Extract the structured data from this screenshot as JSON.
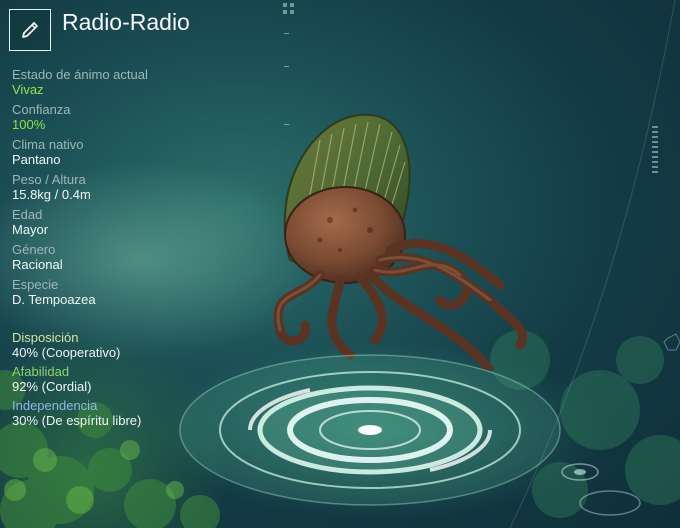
{
  "header": {
    "title": "Radio-Radio",
    "edit_icon": "pencil-icon"
  },
  "stats": [
    {
      "label": "Estado de ánimo actual",
      "value": "Vivaz",
      "highlight": true
    },
    {
      "label": "Confianza",
      "value": "100%",
      "highlight": true
    },
    {
      "label": "Clima nativo",
      "value": "Pantano",
      "highlight": false
    },
    {
      "label": "Peso / Altura",
      "value": "15.8kg / 0.4m",
      "highlight": false
    },
    {
      "label": "Edad",
      "value": "Mayor",
      "highlight": false
    },
    {
      "label": "Género",
      "value": "Racional",
      "highlight": false
    },
    {
      "label": "Especie",
      "value": "D. Tempoazea",
      "highlight": false
    }
  ],
  "traits": [
    {
      "label": "Disposición",
      "value": "40% (Cooperativo)",
      "color": "#d7e39a"
    },
    {
      "label": "Afabilidad",
      "value": "92% (Cordial)",
      "color": "#8fd46a"
    },
    {
      "label": "Independencia",
      "value": "30% (De espíritu libre)",
      "color": "#8fb8e8"
    }
  ],
  "colors": {
    "accent_green": "#8fe34a",
    "label_gray": "#9fb7b6",
    "text_white": "#f1f6f5"
  }
}
